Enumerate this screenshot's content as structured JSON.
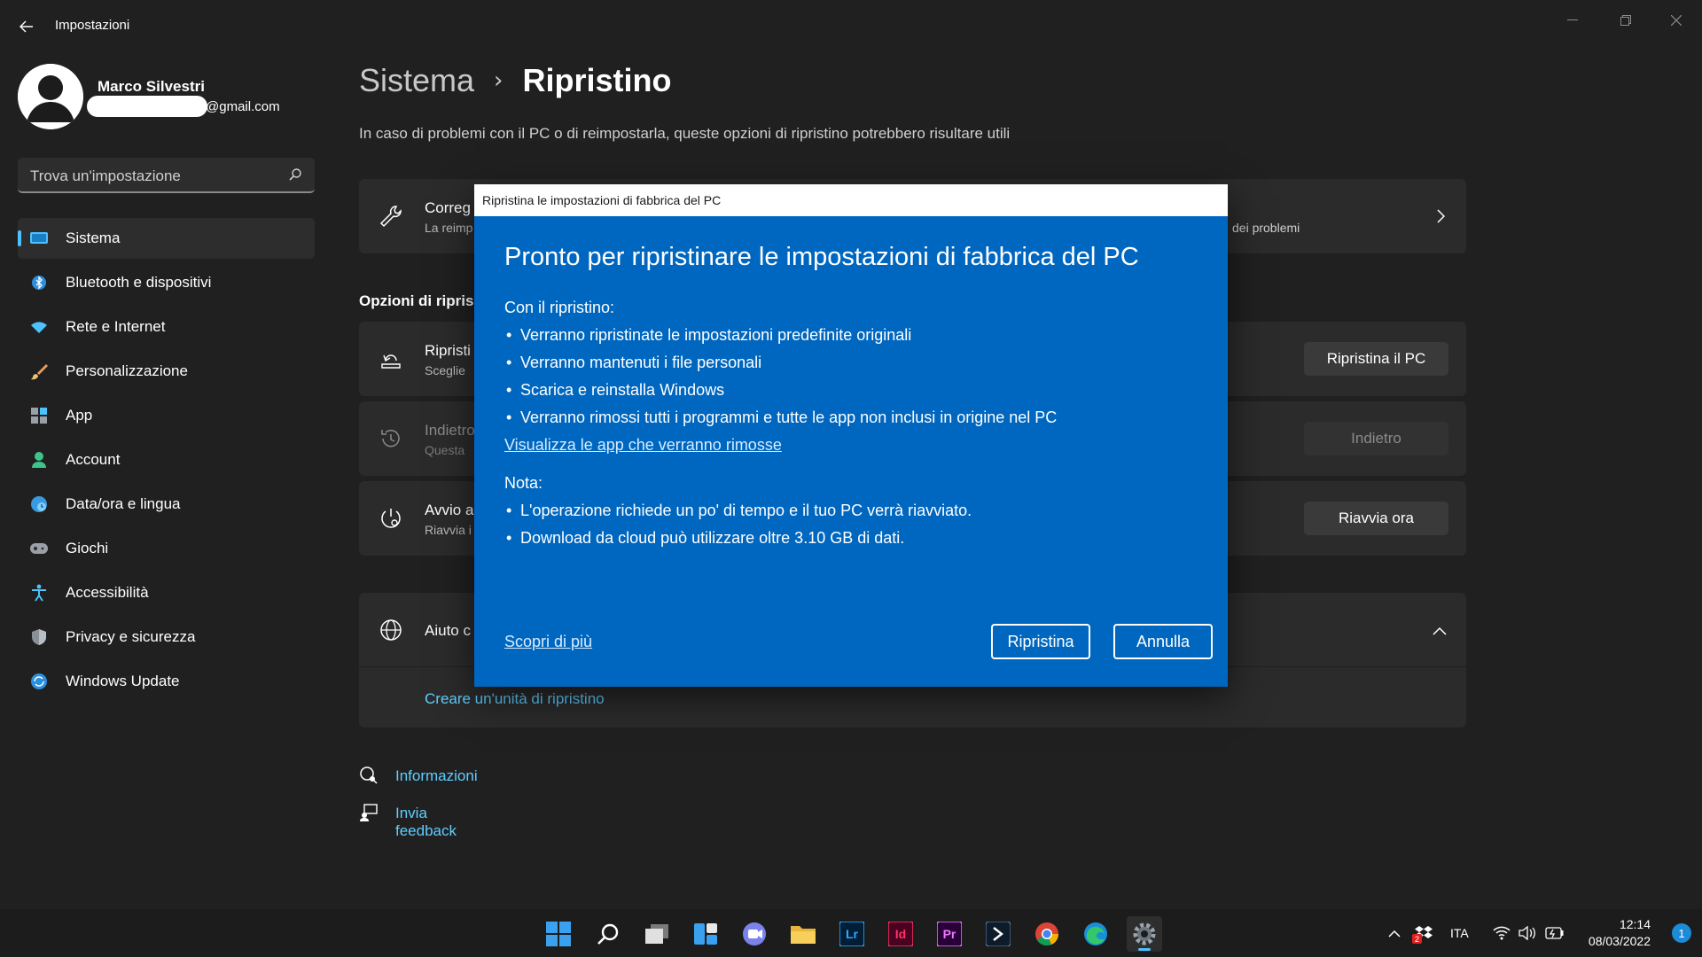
{
  "window": {
    "title": "Impostazioni"
  },
  "profile": {
    "name": "Marco Silvestri",
    "email_suffix": "@gmail.com"
  },
  "search": {
    "placeholder": "Trova un'impostazione"
  },
  "sidebar": {
    "items": [
      {
        "label": "Sistema",
        "icon": "system-icon",
        "active": true
      },
      {
        "label": "Bluetooth e dispositivi",
        "icon": "bluetooth-icon"
      },
      {
        "label": "Rete e Internet",
        "icon": "wifi-icon"
      },
      {
        "label": "Personalizzazione",
        "icon": "brush-icon"
      },
      {
        "label": "App",
        "icon": "apps-icon"
      },
      {
        "label": "Account",
        "icon": "account-icon"
      },
      {
        "label": "Data/ora e lingua",
        "icon": "clock-globe-icon"
      },
      {
        "label": "Giochi",
        "icon": "gamepad-icon"
      },
      {
        "label": "Accessibilità",
        "icon": "accessibility-icon"
      },
      {
        "label": "Privacy e sicurezza",
        "icon": "shield-icon"
      },
      {
        "label": "Windows Update",
        "icon": "update-icon"
      }
    ]
  },
  "main": {
    "breadcrumb_parent": "Sistema",
    "breadcrumb_current": "Ripristino",
    "subtitle": "In caso di problemi con il PC o di reimpostarla, queste opzioni di ripristino potrebbero risultare utili",
    "troubleshoot_card": {
      "title": "Correg",
      "desc": "La reimp",
      "desc_tail": "dei problemi"
    },
    "options_heading": "Opzioni di ripris",
    "reset_card": {
      "title": "Ripristi",
      "desc": "Sceglie",
      "button": "Ripristina il PC"
    },
    "goback_card": {
      "title": "Indietro",
      "desc": "Questa",
      "button": "Indietro"
    },
    "advanced_card": {
      "title": "Avvio a",
      "desc": "Riavvia i",
      "button": "Riavvia ora"
    },
    "help_card": {
      "title": "Aiuto c",
      "link": "Creare un'unità di ripristino"
    },
    "footer_links": [
      "Informazioni",
      "Invia feedback"
    ]
  },
  "dialog": {
    "title": "Ripristina le impostazioni di fabbrica del PC",
    "heading": "Pronto per ripristinare le impostazioni di fabbrica del PC",
    "intro": "Con il ripristino:",
    "bullets": [
      "Verranno ripristinate le impostazioni predefinite originali",
      "Verranno mantenuti i file personali",
      "Scarica e reinstalla Windows",
      "Verranno rimossi tutti i programmi e tutte le app non inclusi in origine nel PC"
    ],
    "apps_link": "Visualizza le app che verranno rimosse",
    "note_label": "Nota:",
    "note_bullets": [
      "L'operazione richiede un po' di tempo e il tuo PC verrà riavviato.",
      "Download da cloud può utilizzare oltre 3.10 GB di dati."
    ],
    "learn_more": "Scopri di più",
    "confirm_button": "Ripristina",
    "cancel_button": "Annulla"
  },
  "taskbar": {
    "apps": [
      "start-icon",
      "search-icon",
      "task-view-icon",
      "widgets-icon",
      "teams-chat-icon",
      "file-explorer-icon",
      "lightroom-icon",
      "indesign-icon",
      "premiere-icon",
      "app-icon",
      "chrome-icon",
      "edge-icon",
      "settings-icon"
    ],
    "lr_label": "Lr",
    "id_label": "Id",
    "pr_label": "Pr",
    "language": "ITA",
    "time": "12:14",
    "date": "08/03/2022",
    "notification_count": "1",
    "dropbox_badge": "2"
  },
  "colors": {
    "background": "#202020",
    "card": "#2b2b2b",
    "accent": "#4cc2ff",
    "dialog": "#0067c0",
    "link": "#60cdff"
  }
}
